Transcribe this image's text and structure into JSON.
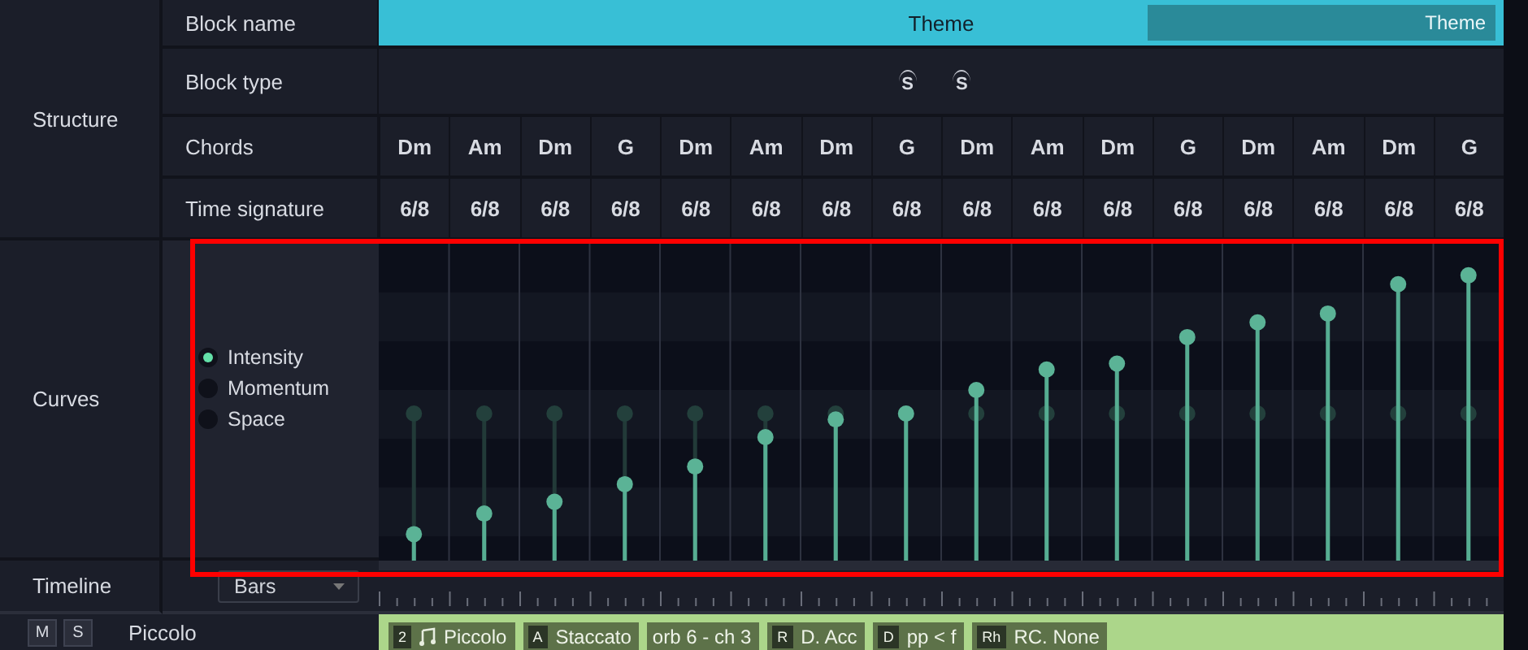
{
  "structure": {
    "label": "Structure",
    "block_name": {
      "label": "Block name",
      "value": "Theme",
      "tag": "Theme"
    },
    "block_type": {
      "label": "Block type",
      "markers": [
        "S",
        "S"
      ]
    },
    "chords": {
      "label": "Chords",
      "values": [
        "Dm",
        "Am",
        "Dm",
        "G",
        "Dm",
        "Am",
        "Dm",
        "G",
        "Dm",
        "Am",
        "Dm",
        "G",
        "Dm",
        "Am",
        "Dm",
        "G"
      ]
    },
    "time_signature": {
      "label": "Time signature",
      "values": [
        "6/8",
        "6/8",
        "6/8",
        "6/8",
        "6/8",
        "6/8",
        "6/8",
        "6/8",
        "6/8",
        "6/8",
        "6/8",
        "6/8",
        "6/8",
        "6/8",
        "6/8",
        "6/8"
      ]
    }
  },
  "curves": {
    "label": "Curves",
    "series": [
      {
        "name": "Intensity",
        "selected": true
      },
      {
        "name": "Momentum",
        "selected": false
      },
      {
        "name": "Space",
        "selected": false
      }
    ]
  },
  "timeline": {
    "label": "Timeline",
    "mode": "Bars"
  },
  "track": {
    "mute": "M",
    "solo": "S",
    "name": "Piccolo",
    "chips": [
      {
        "kind": "instrument",
        "badge": "2",
        "text": "Piccolo"
      },
      {
        "kind": "setting",
        "badge": "A",
        "text": "Staccato"
      },
      {
        "kind": "setting",
        "text": "orb 6 - ch 3"
      },
      {
        "kind": "setting",
        "badge": "R",
        "text": "D. Acc"
      },
      {
        "kind": "setting",
        "badge": "D",
        "text": "pp < f"
      },
      {
        "kind": "setting",
        "badge": "Rh",
        "text": "RC. None"
      }
    ]
  }
}
